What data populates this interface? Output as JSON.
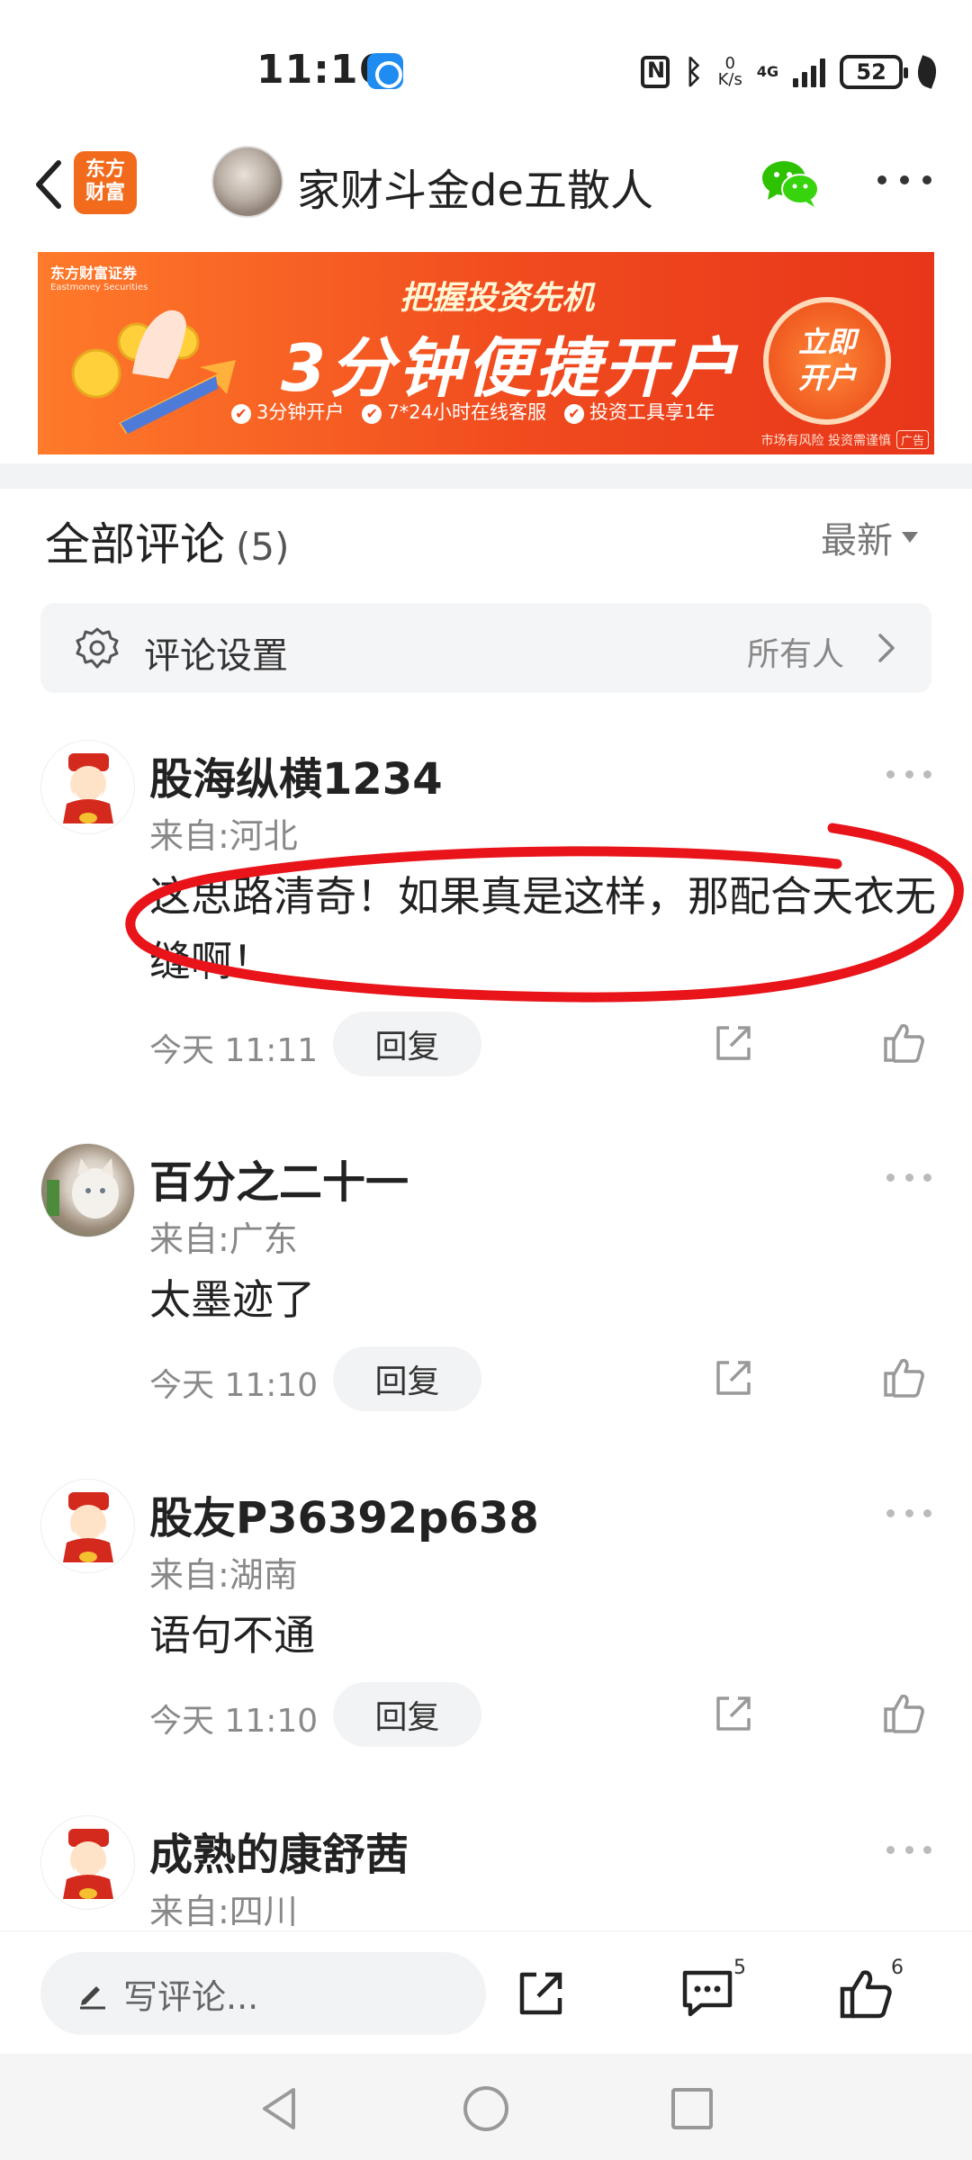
{
  "status_bar": {
    "time": "11:16",
    "net_speed_value": "0",
    "net_speed_unit": "K/s",
    "network": "4G",
    "battery": "52"
  },
  "nav": {
    "app_logo_line1": "东方",
    "app_logo_line2": "财富",
    "author_name": "家财斗金de五散人"
  },
  "ad": {
    "brand": "东方财富证券",
    "brand_en": "Eastmoney Securities",
    "headline": "把握投资先机",
    "big_text": "3分钟便捷开户",
    "features": [
      "3分钟开户",
      "7*24小时在线客服",
      "投资工具享1年"
    ],
    "cta_line1": "立即",
    "cta_line2": "开户",
    "disclaimer": "市场有风险 投资需谨慎",
    "tag": "广告"
  },
  "comments_header": {
    "title": "全部评论",
    "count": "(5)",
    "sort": "最新"
  },
  "settings": {
    "label": "评论设置",
    "value": "所有人"
  },
  "comments": [
    {
      "name": "股海纵横1234",
      "location": "来自:河北",
      "text": "这思路清奇！如果真是这样，那配合天衣无缝啊！",
      "time": "今天 11:11",
      "reply": "回复"
    },
    {
      "name": "百分之二十一",
      "location": "来自:广东",
      "text": "太墨迹了",
      "time": "今天 11:10",
      "reply": "回复"
    },
    {
      "name": "股友P36392p638",
      "location": "来自:湖南",
      "text": "语句不通",
      "time": "今天 11:10",
      "reply": "回复"
    },
    {
      "name": "成熟的康舒茜",
      "location": "来自:四川"
    }
  ],
  "bottom_bar": {
    "write_placeholder": "写评论...",
    "comment_count": "5",
    "like_count": "6"
  },
  "colors": {
    "brand_orange": "#f26a1b",
    "ad_red": "#f04a1e",
    "annotation_red": "#e8141a",
    "wechat_green": "#2dc100"
  }
}
